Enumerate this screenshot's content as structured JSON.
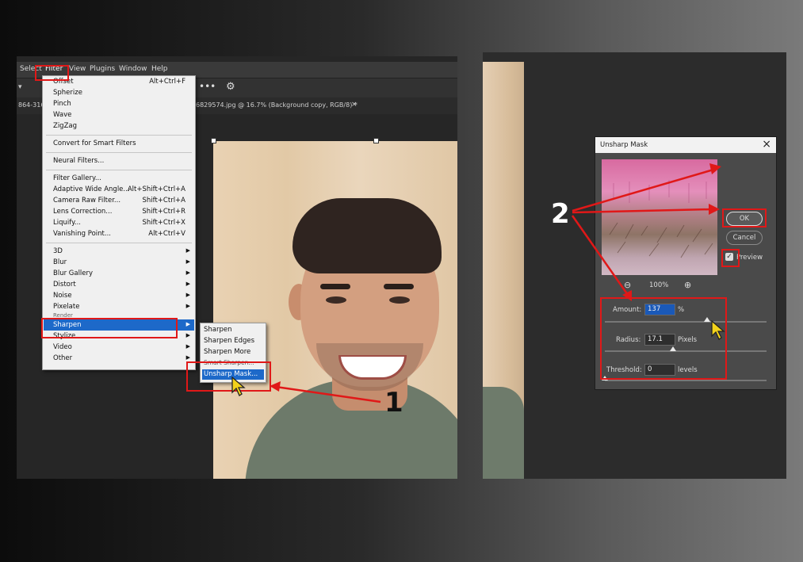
{
  "ps": {
    "menubar": [
      "Select",
      "Filter",
      "View",
      "Plugins",
      "Window",
      "Help"
    ],
    "tab_title": "6829574.jpg @ 16.7% (Background copy, RGB/8) *",
    "tab_left": "864-316",
    "filter_menu": {
      "group1": [
        "Offset",
        "Spherize",
        "Pinch",
        "Wave",
        "ZigZag"
      ],
      "offset_shortcut": "Alt+Ctrl+F",
      "convert": "Convert for Smart Filters",
      "neural": "Neural Filters...",
      "gallery": [
        {
          "label": "Filter Gallery...",
          "shortcut": ""
        },
        {
          "label": "Adaptive Wide Angle...",
          "shortcut": "Alt+Shift+Ctrl+A"
        },
        {
          "label": "Camera Raw Filter...",
          "shortcut": "Shift+Ctrl+A"
        },
        {
          "label": "Lens Correction...",
          "shortcut": "Shift+Ctrl+R"
        },
        {
          "label": "Liquify...",
          "shortcut": "Shift+Ctrl+X"
        },
        {
          "label": "Vanishing Point...",
          "shortcut": "Alt+Ctrl+V"
        }
      ],
      "categories": [
        "3D",
        "Blur",
        "Blur Gallery",
        "Distort",
        "Noise",
        "Pixelate",
        "Render",
        "Sharpen",
        "Stylize",
        "Video",
        "Other"
      ]
    },
    "sharpen_submenu": [
      "Sharpen",
      "Sharpen Edges",
      "Sharpen More",
      "Smart Sharpen...",
      "Unsharp Mask..."
    ]
  },
  "dialog": {
    "title": "Unsharp Mask",
    "ok": "OK",
    "cancel": "Cancel",
    "preview_label": "Preview",
    "zoom": "100%",
    "amount_label": "Amount:",
    "amount_value": "137",
    "amount_unit": "%",
    "radius_label": "Radius:",
    "radius_value": "17.1",
    "radius_unit": "Pixels",
    "threshold_label": "Threshold:",
    "threshold_value": "0",
    "threshold_unit": "levels"
  },
  "steps": {
    "one": "1",
    "two": "2"
  },
  "icons": {
    "close": "close-icon",
    "zoom_out": "zoom-out-icon",
    "zoom_in": "zoom-in-icon",
    "gear": "gear-icon",
    "more": "more-icon",
    "cursor": "cursor-icon"
  },
  "colors": {
    "highlight": "#1d69c9",
    "annotation": "#e01818",
    "cursor": "#f2d21b"
  }
}
